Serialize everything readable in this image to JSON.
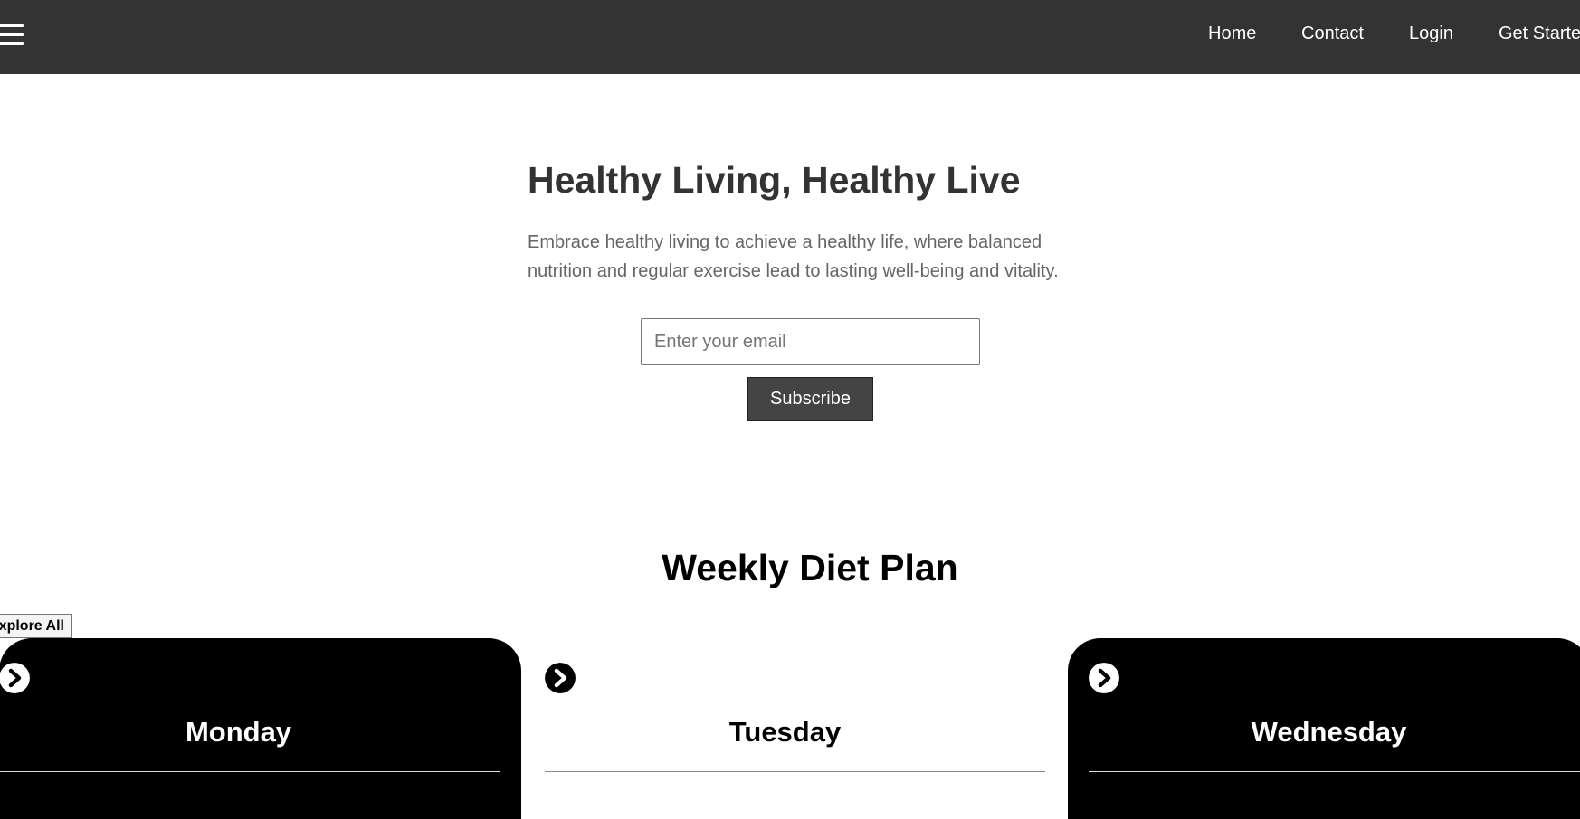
{
  "nav": {
    "menu_icon": "hamburger-menu-icon",
    "links": [
      "Home",
      "Contact",
      "Login",
      "Get Started"
    ]
  },
  "hero": {
    "title": "Healthy Living, Healthy Live",
    "description": "Embrace healthy living to achieve a healthy life, where balanced nutrition and regular exercise lead to lasting well-being and vitality.",
    "email_placeholder": "Enter your email",
    "subscribe_label": "Subscribe"
  },
  "diet_plan": {
    "title": "Weekly Diet Plan",
    "explore_label": "Explore All",
    "days": [
      {
        "name": "Monday",
        "icon": "chevron-right-circle-icon",
        "theme": "dark"
      },
      {
        "name": "Tuesday",
        "icon": "chevron-right-circle-icon",
        "theme": "light"
      },
      {
        "name": "Wednesday",
        "icon": "chevron-right-circle-icon",
        "theme": "dark"
      }
    ]
  },
  "colors": {
    "header_bg": "#333333",
    "button_bg": "#444444",
    "card_dark": "#000000",
    "card_light": "#ffffff"
  }
}
